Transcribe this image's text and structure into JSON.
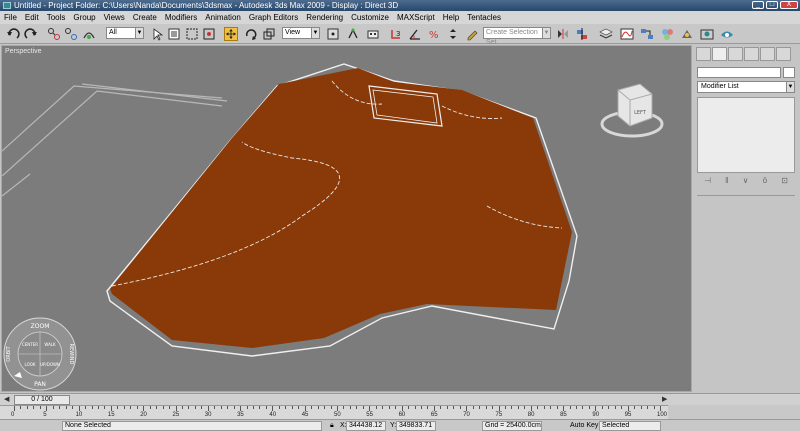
{
  "window": {
    "title": "Untitled      - Project Folder: C:\\Users\\Nanda\\Documents\\3dsmax      - Autodesk 3ds Max  2009       - Display : Direct 3D",
    "controls": [
      "_",
      "□",
      "X"
    ]
  },
  "menu": {
    "items": [
      "File",
      "Edit",
      "Tools",
      "Group",
      "Views",
      "Create",
      "Modifiers",
      "Animation",
      "Graph Editors",
      "Rendering",
      "Customize",
      "MAXScript",
      "Help",
      "Tentacles"
    ]
  },
  "toolbar": {
    "selection_filter": "All",
    "reference_coord": "View",
    "named_selection_placeholder": "Create Selection Set"
  },
  "viewport": {
    "label": "Perspective",
    "viewcube_face": "LEFT",
    "steering_wheel": {
      "top": "ZOOM",
      "bottom": "PAN",
      "left": "ORBIT",
      "right": "REWIND",
      "inner_left": "CENTER",
      "inner_right": "WALK",
      "inner_bottom_left": "LOOK",
      "inner_bottom_right": "UP/DOWN"
    },
    "colors": {
      "background": "#7c7c7c",
      "terrain_fill": "#8a3908",
      "terrain_outline": "#f0f0f0",
      "grid_lines": "#b8b8b8"
    }
  },
  "command_panel": {
    "modifier_list_label": "Modifier List"
  },
  "timeline": {
    "frame_display": "0 / 100",
    "ruler_ticks": [
      "0",
      "5",
      "10",
      "15",
      "20",
      "25",
      "30",
      "35",
      "40",
      "45",
      "50",
      "55",
      "60",
      "65",
      "70",
      "75",
      "80",
      "85",
      "90",
      "95",
      "100"
    ]
  },
  "statusbar": {
    "selection_status": "None Selected",
    "x_label": "X:",
    "x_value": "344438.12",
    "y_label": "Y:",
    "y_value": "349833.71",
    "grid_value": "Grid = 25400.0cm",
    "auto_key_label": "Auto Key",
    "key_mode": "Selected"
  }
}
